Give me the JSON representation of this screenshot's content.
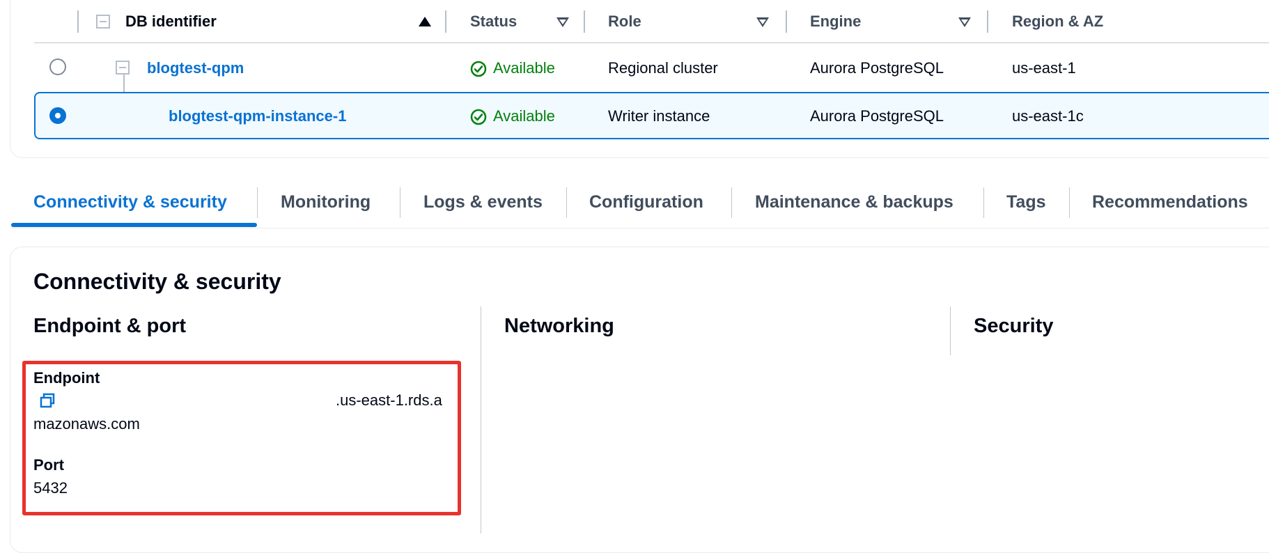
{
  "table": {
    "columns": {
      "db_identifier": "DB identifier",
      "status": "Status",
      "role": "Role",
      "engine": "Engine",
      "region_az": "Region & AZ"
    },
    "rows": [
      {
        "identifier": "blogtest-qpm",
        "status": "Available",
        "role": "Regional cluster",
        "engine": "Aurora PostgreSQL",
        "region": "us-east-1",
        "selected": false
      },
      {
        "identifier": "blogtest-qpm-instance-1",
        "status": "Available",
        "role": "Writer instance",
        "engine": "Aurora PostgreSQL",
        "region": "us-east-1c",
        "selected": true
      }
    ]
  },
  "tabs": [
    {
      "label": "Connectivity & security",
      "active": true
    },
    {
      "label": "Monitoring",
      "active": false
    },
    {
      "label": "Logs & events",
      "active": false
    },
    {
      "label": "Configuration",
      "active": false
    },
    {
      "label": "Maintenance & backups",
      "active": false
    },
    {
      "label": "Tags",
      "active": false
    },
    {
      "label": "Recommendations",
      "active": false
    }
  ],
  "details": {
    "title": "Connectivity & security",
    "columns": {
      "endpoint_port": "Endpoint & port",
      "networking": "Networking",
      "security": "Security"
    },
    "endpoint_label": "Endpoint",
    "endpoint_value_line1": ".us-east-1.rds.a",
    "endpoint_value_line2": "mazonaws.com",
    "port_label": "Port",
    "port_value": "5432"
  },
  "colors": {
    "link": "#0972d3",
    "available": "#037f0c",
    "highlight": "#e8322b"
  }
}
